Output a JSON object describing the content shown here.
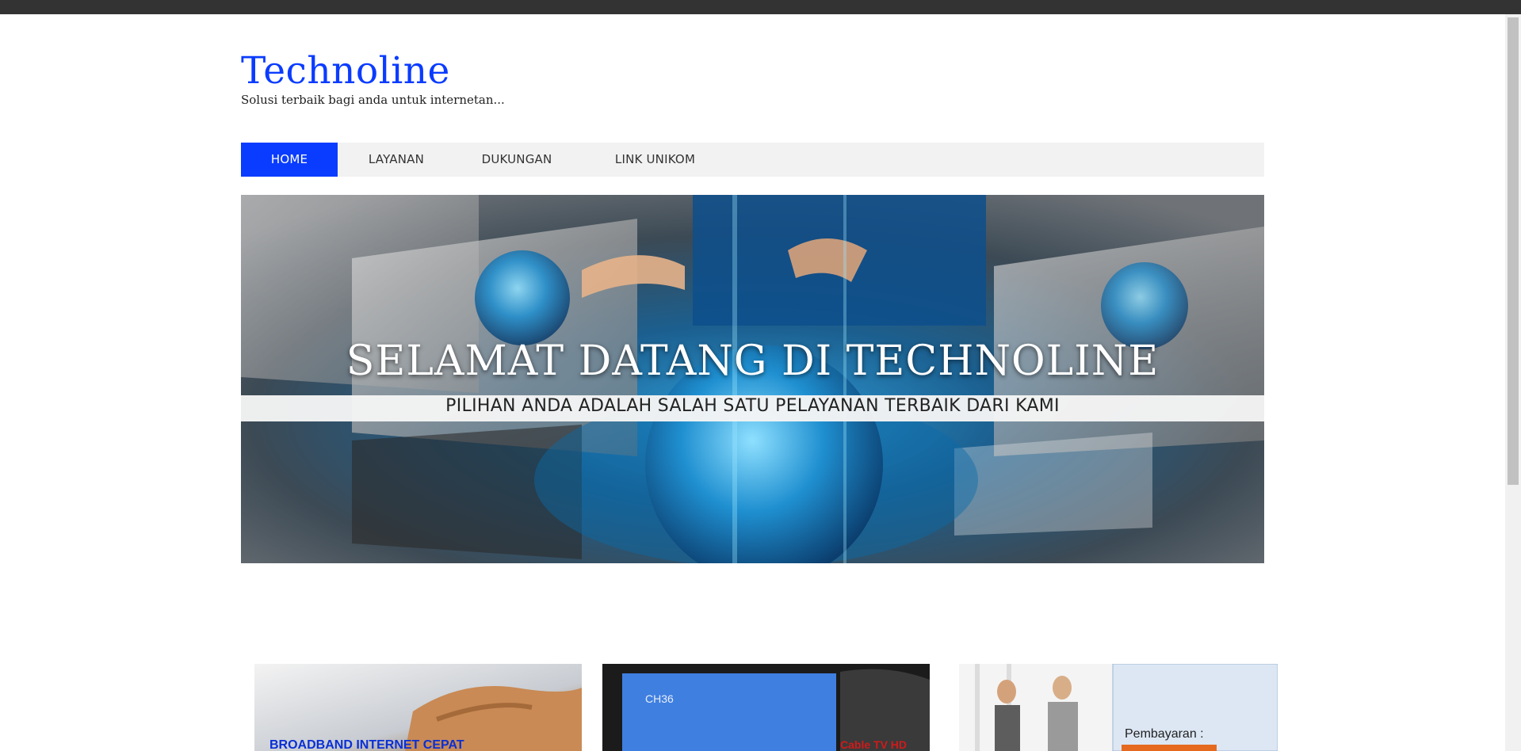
{
  "site": {
    "title": "Technoline",
    "tagline": "Solusi terbaik bagi anda untuk internetan..."
  },
  "nav": {
    "items": [
      {
        "label": "HOME",
        "active": true
      },
      {
        "label": "LAYANAN",
        "active": false
      },
      {
        "label": "DUKUNGAN",
        "active": false
      },
      {
        "label": "LINK UNIKOM",
        "active": false
      }
    ]
  },
  "hero": {
    "title": "SELAMAT DATANG DI TECHNOLINE",
    "subtitle": "PILIHAN ANDA ADALAH SALAH SATU PELAYANAN TERBAIK DARI KAMI"
  },
  "cards": [
    {
      "text": "BROADBAND INTERNET CEPAT"
    },
    {
      "screen_text": "CH36",
      "caption": "Cable TV HD"
    },
    {
      "caption": "Pembayaran :"
    }
  ],
  "colors": {
    "accent": "#0a3cff",
    "nav_bg": "#f2f2f2",
    "top_bar": "#333333"
  }
}
